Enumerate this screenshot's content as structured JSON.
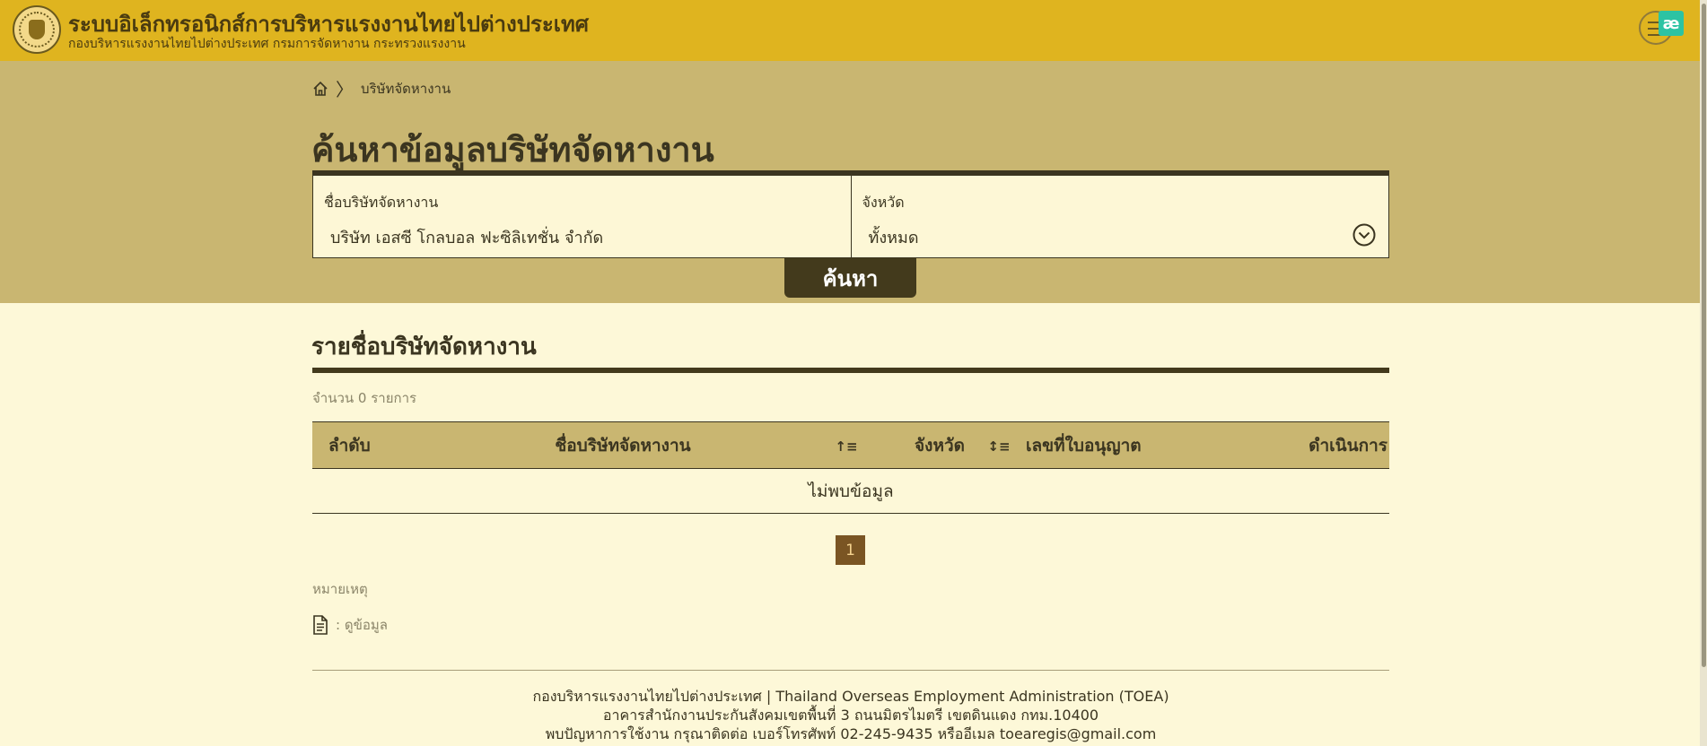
{
  "header": {
    "title": "ระบบอิเล็กทรอนิกส์การบริหารแรงงานไทยไปต่างประเทศ",
    "subtitle": "กองบริหารแรงงานไทยไปต่างประเทศ กรมการจัดหางาน กระทรวงแรงงาน",
    "extension_badge": "æ"
  },
  "breadcrumb": {
    "current": "บริษัทจัดหางาน"
  },
  "search": {
    "page_title": "ค้นหาข้อมูลบริษัทจัดหางาน",
    "company_label": "ชื่อบริษัทจัดหางาน",
    "company_value": "บริษัท เอสซี โกลบอล ฟะซิลิเทชั่น จำกัด",
    "province_label": "จังหวัด",
    "province_value": "ทั้งหมด",
    "button_label": "ค้นหา"
  },
  "results": {
    "title": "รายชื่อบริษัทจัดหางาน",
    "count_text": "จำนวน 0 รายการ",
    "columns": [
      "ลำดับ",
      "ชื่อบริษัทจัดหางาน",
      "จังหวัด",
      "เลขที่ใบอนุญาต",
      "ดำเนินการ"
    ],
    "empty_text": "ไม่พบข้อมูล",
    "page": "1"
  },
  "notes": {
    "title": "หมายเหตุ",
    "view_label": ": ดูข้อมูล"
  },
  "footer": {
    "line1": "กองบริหารแรงงานไทยไปต่างประเทศ | Thailand Overseas Employment Administration (TOEA)",
    "line2": "อาคารสำนักงานประกันสังคมเขตพื้นที่ 3 ถนนมิตรไมตรี เขตดินแดง กทม.10400",
    "line3": "พบปัญหาการใช้งาน กรุณาติดต่อ เบอร์โทรศัพท์ 02-245-9435 หรืออีเมล toearegis@gmail.com"
  },
  "colors": {
    "header_bg": "#dfb41f",
    "band_bg": "#c9b671",
    "page_bg": "#fdf8d8",
    "dark": "#433a1c",
    "page_active": "#7a5523"
  }
}
